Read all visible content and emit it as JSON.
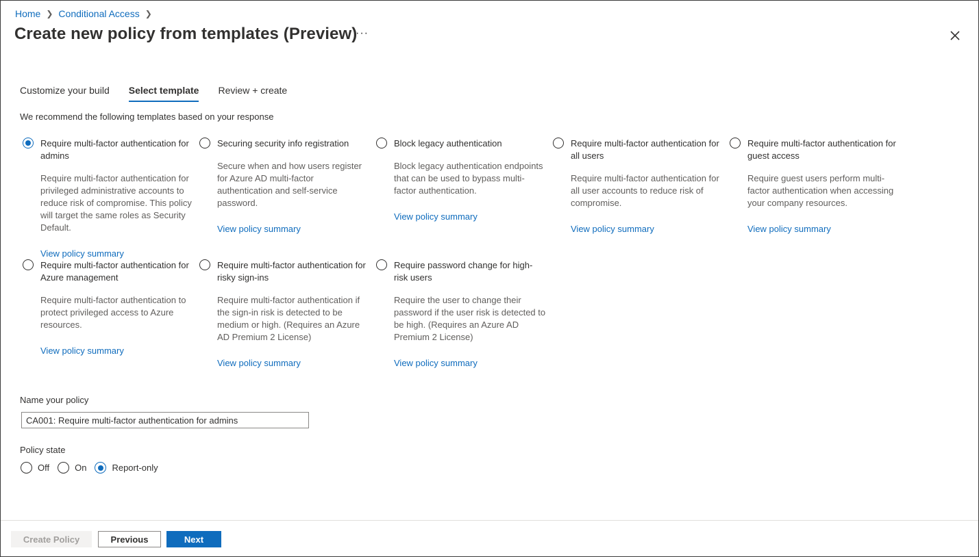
{
  "breadcrumb": {
    "home": "Home",
    "section": "Conditional Access"
  },
  "page": {
    "title": "Create new policy from templates (Preview)",
    "more": "···"
  },
  "tabs": [
    {
      "label": "Customize your build",
      "active": false
    },
    {
      "label": "Select template",
      "active": true
    },
    {
      "label": "Review + create",
      "active": false
    }
  ],
  "intro": "We recommend the following templates based on your response",
  "templates": [
    {
      "title": "Require multi-factor authentication for admins",
      "description": "Require multi-factor authentication for privileged administrative accounts to reduce risk of compromise. This policy will target the same roles as Security Default.",
      "link": "View policy summary",
      "selected": true
    },
    {
      "title": "Securing security info registration",
      "description": "Secure when and how users register for Azure AD multi-factor authentication and self-service password.",
      "link": "View policy summary",
      "selected": false
    },
    {
      "title": "Block legacy authentication",
      "description": "Block legacy authentication endpoints that can be used to bypass multi-factor authentication.",
      "link": "View policy summary",
      "selected": false
    },
    {
      "title": "Require multi-factor authentication for all users",
      "description": "Require multi-factor authentication for all user accounts to reduce risk of compromise.",
      "link": "View policy summary",
      "selected": false
    },
    {
      "title": "Require multi-factor authentication for guest access",
      "description": "Require guest users perform multi-factor authentication when accessing your company resources.",
      "link": "View policy summary",
      "selected": false
    },
    {
      "title": "Require multi-factor authentication for Azure management",
      "description": "Require multi-factor authentication to protect privileged access to Azure resources.",
      "link": "View policy summary",
      "selected": false
    },
    {
      "title": "Require multi-factor authentication for risky sign-ins",
      "description": "Require multi-factor authentication if the sign-in risk is detected to be medium or high. (Requires an Azure AD Premium 2 License)",
      "link": "View policy summary",
      "selected": false
    },
    {
      "title": "Require password change for high-risk users",
      "description": "Require the user to change their password if the user risk is detected to be high. (Requires an Azure AD Premium 2 License)",
      "link": "View policy summary",
      "selected": false
    }
  ],
  "name_policy": {
    "label": "Name your policy",
    "value": "CA001: Require multi-factor authentication for admins"
  },
  "policy_state": {
    "label": "Policy state",
    "options": [
      {
        "label": "Off",
        "selected": false
      },
      {
        "label": "On",
        "selected": false
      },
      {
        "label": "Report-only",
        "selected": true
      }
    ]
  },
  "footer": {
    "create": "Create Policy",
    "previous": "Previous",
    "next": "Next"
  },
  "colors": {
    "accent": "#0f6cbd",
    "text": "#323130",
    "muted": "#605e5c"
  }
}
